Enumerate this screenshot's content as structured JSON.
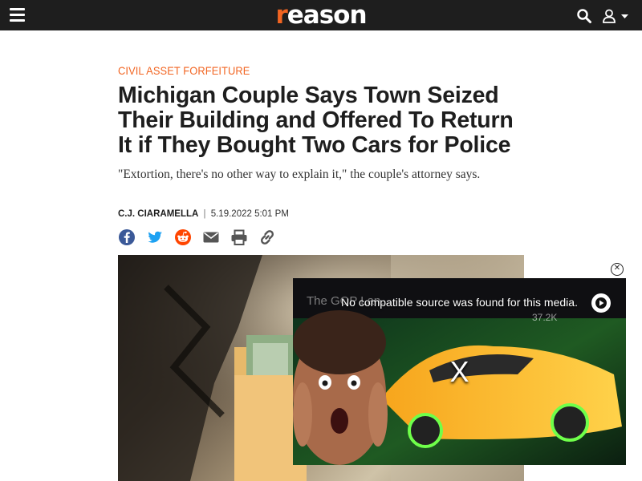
{
  "site": {
    "logo_text": "reason",
    "accent_color": "#f26522",
    "bar_color": "#1e1e1e"
  },
  "nav": {
    "menu_icon": "hamburger-icon",
    "search_icon": "search-icon",
    "user_icon": "user-icon",
    "dropdown_icon": "caret-down-icon"
  },
  "article": {
    "category": "CIVIL ASSET FORFEITURE",
    "headline": "Michigan Couple Says Town Seized Their Building and Offered To Return It if They Bought Two Cars for Police",
    "subhead": "\"Extortion, there's no other way to explain it,\" the couple's attorney says.",
    "author": "C.J. CIARAMELLA",
    "separator": "|",
    "date": "5.19.2022 5:01 PM"
  },
  "share": [
    {
      "name": "facebook-share-button",
      "icon": "facebook-icon",
      "color": "#3b5998"
    },
    {
      "name": "twitter-share-button",
      "icon": "twitter-icon",
      "color": "#1da1f2"
    },
    {
      "name": "reddit-share-button",
      "icon": "reddit-icon",
      "color": "#ff4500"
    },
    {
      "name": "email-share-button",
      "icon": "email-icon",
      "color": "#555555"
    },
    {
      "name": "print-button",
      "icon": "print-icon",
      "color": "#555555"
    },
    {
      "name": "copy-link-button",
      "icon": "link-icon",
      "color": "#555555"
    }
  ],
  "video": {
    "error_message": "No compatible source was found for this media.",
    "ghost_title": "The GOP Lan…",
    "views": "37.2K",
    "close_mark": "X",
    "close_button": "✕"
  }
}
